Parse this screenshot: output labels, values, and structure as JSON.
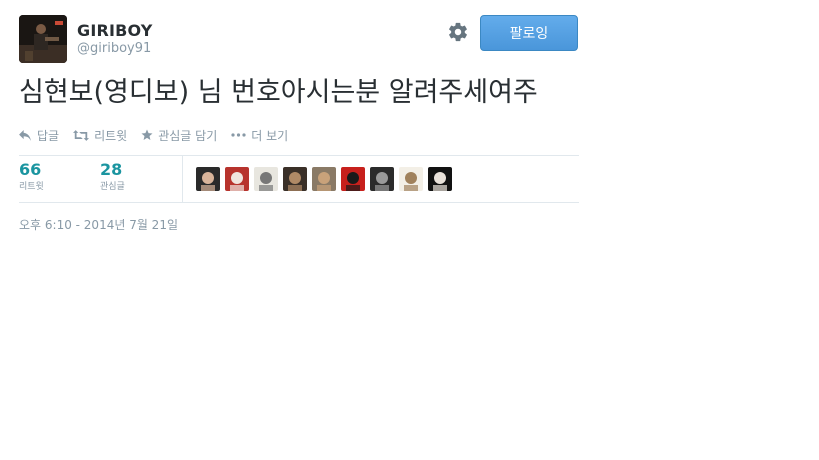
{
  "user": {
    "fullname": "GIRIBOY",
    "screenname": "@giriboy91"
  },
  "header": {
    "follow_label": "팔로잉",
    "settings_icon": "gear-icon"
  },
  "tweet": {
    "text": "심현보(영디보) 님 번호아시는분 알려주세여주"
  },
  "actions": [
    {
      "label": "답글",
      "icon": "reply-icon"
    },
    {
      "label": "리트윗",
      "icon": "retweet-icon"
    },
    {
      "label": "관심글 담기",
      "icon": "star-icon"
    },
    {
      "label": "더 보기",
      "icon": "more-icon"
    }
  ],
  "stats": {
    "retweets": {
      "count": "66",
      "label": "리트윗"
    },
    "favorites": {
      "count": "28",
      "label": "관심글"
    }
  },
  "faces": [
    {
      "name": "avatar-1",
      "bg": "#2a2a2a",
      "fg": "#d9b49a"
    },
    {
      "name": "avatar-2",
      "bg": "#b7332d",
      "fg": "#f0e6df"
    },
    {
      "name": "avatar-3",
      "bg": "#e8e6df",
      "fg": "#777777"
    },
    {
      "name": "avatar-4",
      "bg": "#3a3028",
      "fg": "#b08a66"
    },
    {
      "name": "avatar-5",
      "bg": "#8a7a66",
      "fg": "#c9a27a"
    },
    {
      "name": "avatar-6",
      "bg": "#c7201c",
      "fg": "#1a1a1a"
    },
    {
      "name": "avatar-7",
      "bg": "#2b2b2b",
      "fg": "#9a9a9a"
    },
    {
      "name": "avatar-8",
      "bg": "#f3efe6",
      "fg": "#a0815c"
    },
    {
      "name": "avatar-9",
      "bg": "#121212",
      "fg": "#e9e2da"
    }
  ],
  "timestamp": "오후 6:10 - 2014년 7월 21일",
  "colors": {
    "accent": "#55acee",
    "stat": "#1b95a0",
    "muted": "#8899a6"
  }
}
